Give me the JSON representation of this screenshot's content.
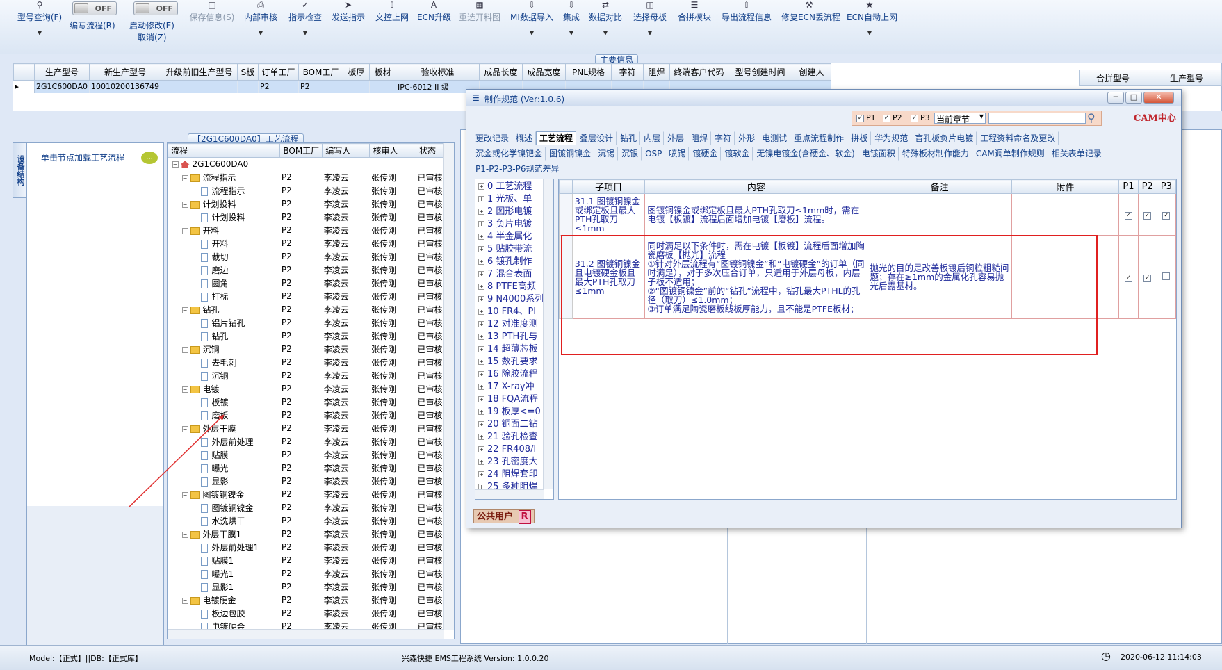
{
  "toolbar": {
    "model_query": "型号查询(F)",
    "edit_flow": "编写流程(R)",
    "edit_flow_toggle": "OFF",
    "start_modify": "启动修改(E)",
    "start_modify_toggle": "OFF",
    "cancel": "取消(Z)",
    "save_info": "保存信息(S)",
    "internal_review": "内部审核",
    "indicator_check": "指示检查",
    "send_indicator": "发送指示",
    "doc_upload": "文控上网",
    "ecn_upgrade": "ECN升级",
    "reselect_drawing": "重选开料图",
    "mi_import": "MI数据导入",
    "integrate": "集成",
    "data_compare": "数据对比",
    "select_template": "选择母板",
    "merge_module": "合拼模块",
    "export_flow_info": "导出流程信息",
    "fix_ecn_flow": "修复ECN丢流程",
    "ecn_auto_upload": "ECN自动上网"
  },
  "main_info": {
    "title": "主要信息",
    "columns": [
      "生产型号",
      "新生产型号",
      "升级前旧生产型号",
      "S板",
      "订单工厂",
      "BOM工厂",
      "板厚",
      "板材",
      "验收标准",
      "成品长度",
      "成品宽度",
      "PNL规格",
      "字符",
      "阻焊",
      "终端客户代码",
      "型号创建时间",
      "创建人"
    ],
    "row": [
      "2G1C600DA0",
      "10010200136749",
      "",
      "",
      "P2",
      "P2",
      "",
      "",
      "IPC-6012 II 级",
      "",
      "",
      "",
      "",
      "",
      "",
      "",
      ""
    ],
    "right_columns": [
      "合拼型号",
      "生产型号"
    ]
  },
  "left": {
    "vertical_tab": "设备结构",
    "node_hint": "单击节点加载工艺流程",
    "flow_title": "【2G1C600DA0】工艺流程",
    "columns": [
      "流程",
      "BOM工厂",
      "编写人",
      "核审人",
      "状态"
    ],
    "rows": [
      {
        "name": "2G1C600DA0",
        "level": 0,
        "kind": "root",
        "factory": "",
        "writer": "",
        "reviewer": "",
        "status": ""
      },
      {
        "name": "流程指示",
        "level": 1,
        "kind": "folder",
        "factory": "P2",
        "writer": "李凌云",
        "reviewer": "张传刚",
        "status": "已审核"
      },
      {
        "name": "流程指示",
        "level": 2,
        "kind": "doc",
        "factory": "P2",
        "writer": "李凌云",
        "reviewer": "张传刚",
        "status": "已审核"
      },
      {
        "name": "计划投料",
        "level": 1,
        "kind": "folder",
        "factory": "P2",
        "writer": "李凌云",
        "reviewer": "张传刚",
        "status": "已审核"
      },
      {
        "name": "计划投料",
        "level": 2,
        "kind": "doc",
        "factory": "P2",
        "writer": "李凌云",
        "reviewer": "张传刚",
        "status": "已审核"
      },
      {
        "name": "开料",
        "level": 1,
        "kind": "folder",
        "factory": "P2",
        "writer": "李凌云",
        "reviewer": "张传刚",
        "status": "已审核"
      },
      {
        "name": "开料",
        "level": 2,
        "kind": "doc",
        "factory": "P2",
        "writer": "李凌云",
        "reviewer": "张传刚",
        "status": "已审核"
      },
      {
        "name": "裁切",
        "level": 2,
        "kind": "doc",
        "factory": "P2",
        "writer": "李凌云",
        "reviewer": "张传刚",
        "status": "已审核"
      },
      {
        "name": "磨边",
        "level": 2,
        "kind": "doc",
        "factory": "P2",
        "writer": "李凌云",
        "reviewer": "张传刚",
        "status": "已审核"
      },
      {
        "name": "圆角",
        "level": 2,
        "kind": "doc",
        "factory": "P2",
        "writer": "李凌云",
        "reviewer": "张传刚",
        "status": "已审核"
      },
      {
        "name": "打标",
        "level": 2,
        "kind": "doc",
        "factory": "P2",
        "writer": "李凌云",
        "reviewer": "张传刚",
        "status": "已审核"
      },
      {
        "name": "钻孔",
        "level": 1,
        "kind": "folder",
        "factory": "P2",
        "writer": "李凌云",
        "reviewer": "张传刚",
        "status": "已审核"
      },
      {
        "name": "铝片钻孔",
        "level": 2,
        "kind": "doc",
        "factory": "P2",
        "writer": "李凌云",
        "reviewer": "张传刚",
        "status": "已审核"
      },
      {
        "name": "钻孔",
        "level": 2,
        "kind": "doc",
        "factory": "P2",
        "writer": "李凌云",
        "reviewer": "张传刚",
        "status": "已审核"
      },
      {
        "name": "沉铜",
        "level": 1,
        "kind": "folder",
        "factory": "P2",
        "writer": "李凌云",
        "reviewer": "张传刚",
        "status": "已审核"
      },
      {
        "name": "去毛刺",
        "level": 2,
        "kind": "doc",
        "factory": "P2",
        "writer": "李凌云",
        "reviewer": "张传刚",
        "status": "已审核"
      },
      {
        "name": "沉铜",
        "level": 2,
        "kind": "doc",
        "factory": "P2",
        "writer": "李凌云",
        "reviewer": "张传刚",
        "status": "已审核"
      },
      {
        "name": "电镀",
        "level": 1,
        "kind": "folder",
        "factory": "P2",
        "writer": "李凌云",
        "reviewer": "张传刚",
        "status": "已审核"
      },
      {
        "name": "板镀",
        "level": 2,
        "kind": "doc",
        "factory": "P2",
        "writer": "李凌云",
        "reviewer": "张传刚",
        "status": "已审核"
      },
      {
        "name": "磨板",
        "level": 2,
        "kind": "doc",
        "factory": "P2",
        "writer": "李凌云",
        "reviewer": "张传刚",
        "status": "已审核"
      },
      {
        "name": "外层干膜",
        "level": 1,
        "kind": "folder",
        "factory": "P2",
        "writer": "李凌云",
        "reviewer": "张传刚",
        "status": "已审核"
      },
      {
        "name": "外层前处理",
        "level": 2,
        "kind": "doc",
        "factory": "P2",
        "writer": "李凌云",
        "reviewer": "张传刚",
        "status": "已审核"
      },
      {
        "name": "贴膜",
        "level": 2,
        "kind": "doc",
        "factory": "P2",
        "writer": "李凌云",
        "reviewer": "张传刚",
        "status": "已审核"
      },
      {
        "name": "曝光",
        "level": 2,
        "kind": "doc",
        "factory": "P2",
        "writer": "李凌云",
        "reviewer": "张传刚",
        "status": "已审核"
      },
      {
        "name": "显影",
        "level": 2,
        "kind": "doc",
        "factory": "P2",
        "writer": "李凌云",
        "reviewer": "张传刚",
        "status": "已审核"
      },
      {
        "name": "图镀铜镍金",
        "level": 1,
        "kind": "folder",
        "factory": "P2",
        "writer": "李凌云",
        "reviewer": "张传刚",
        "status": "已审核"
      },
      {
        "name": "图镀铜镍金",
        "level": 2,
        "kind": "doc",
        "factory": "P2",
        "writer": "李凌云",
        "reviewer": "张传刚",
        "status": "已审核"
      },
      {
        "name": "水洗烘干",
        "level": 2,
        "kind": "doc",
        "factory": "P2",
        "writer": "李凌云",
        "reviewer": "张传刚",
        "status": "已审核"
      },
      {
        "name": "外层干膜1",
        "level": 1,
        "kind": "folder",
        "factory": "P2",
        "writer": "李凌云",
        "reviewer": "张传刚",
        "status": "已审核"
      },
      {
        "name": "外层前处理1",
        "level": 2,
        "kind": "doc",
        "factory": "P2",
        "writer": "李凌云",
        "reviewer": "张传刚",
        "status": "已审核"
      },
      {
        "name": "贴膜1",
        "level": 2,
        "kind": "doc",
        "factory": "P2",
        "writer": "李凌云",
        "reviewer": "张传刚",
        "status": "已审核"
      },
      {
        "name": "曝光1",
        "level": 2,
        "kind": "doc",
        "factory": "P2",
        "writer": "李凌云",
        "reviewer": "张传刚",
        "status": "已审核"
      },
      {
        "name": "显影1",
        "level": 2,
        "kind": "doc",
        "factory": "P2",
        "writer": "李凌云",
        "reviewer": "张传刚",
        "status": "已审核"
      },
      {
        "name": "电镀硬金",
        "level": 1,
        "kind": "folder",
        "factory": "P2",
        "writer": "李凌云",
        "reviewer": "张传刚",
        "status": "已审核"
      },
      {
        "name": "板边包胶",
        "level": 2,
        "kind": "doc",
        "factory": "P2",
        "writer": "李凌云",
        "reviewer": "张传刚",
        "status": "已审核"
      },
      {
        "name": "电镀硬金",
        "level": 2,
        "kind": "doc",
        "factory": "P2",
        "writer": "李凌云",
        "reviewer": "张传刚",
        "status": "已审核"
      }
    ]
  },
  "dialog": {
    "title": "制作规范 (Ver:1.0.6)",
    "filters": [
      {
        "label": "P1",
        "checked": true
      },
      {
        "label": "P2",
        "checked": true
      },
      {
        "label": "P3",
        "checked": true
      }
    ],
    "scope_select": "当前章节",
    "search_value": "",
    "cam_logo": "CAM中心",
    "tabs_row1": [
      "更改记录",
      "概述",
      "工艺流程",
      "叠层设计",
      "钻孔",
      "内层",
      "外层",
      "阻焊",
      "字符",
      "外形",
      "电测试",
      "重点流程制作",
      "拼板",
      "华为规范",
      "盲孔板负片电镀",
      "工程资料命名及更改"
    ],
    "tabs_row2": [
      "沉金或化学镍钯金",
      "图镀铜镍金",
      "沉锡",
      "沉银",
      "OSP",
      "喷锡",
      "镀硬金",
      "镀软金",
      "无镍电镀金(含硬金、软金)",
      "电镀面积",
      "特殊板材制作能力",
      "CAM调单制作规则",
      "相关表单记录"
    ],
    "tabs_row3": [
      "P1-P2-P3-P6规范差异"
    ],
    "active_tab": "工艺流程",
    "chapters": [
      "0 工艺流程",
      "1 光板、单",
      "2 图形电镀",
      "3 负片电镀",
      "4 半金属化",
      "5 贴胶带流",
      "6 镀孔制作",
      "7 混合表面",
      "8 PTFE高频",
      "9 N4000系列",
      "10 FR4、PI",
      "12 对准度测",
      "13 PTH孔与",
      "14 超薄芯板",
      "15 数孔要求",
      "16 除胶流程",
      "17 X-ray冲",
      "18 FQA流程",
      "19 板厚<=0",
      "20 铜面二钻",
      "21 验孔检查",
      "22 FR408/I",
      "23 孔密度大",
      "24 阻焊套印",
      "25 多种阻焊"
    ],
    "spec_columns": [
      "子项目",
      "内容",
      "备注",
      "附件",
      "P1",
      "P2",
      "P3"
    ],
    "spec_rows": [
      {
        "item": "31.1 图镀铜镍金或绑定板且最大PTH孔取刀≤1mm",
        "content": "图镀铜镍金或绑定板且最大PTH孔取刀≤1mm时，需在电镀【板镀】流程后面增加电镀【磨板】流程。",
        "remark": "",
        "attachment": "",
        "p1": true,
        "p2": true,
        "p3": true
      },
      {
        "item": "31.2 图镀铜镍金且电镀硬金板且最大PTH孔取刀≤1mm",
        "content": "同时满足以下条件时，需在电镀【板镀】流程后面增加陶瓷磨板【抛光】流程\n①针对外层流程有“图镀铜镍金”和“电镀硬金”的订单（同时满足），对于多次压合订单，只适用于外层母板，内层子板不适用；\n②“图镀铜镍金”前的“钻孔”流程中，钻孔最大PTHL的孔径（取刀）≤1.0mm；\n③订单满足陶瓷磨板线板厚能力，且不能是PTFE板材；",
        "remark": "抛光的目的是改善板镀后铜粒粗糙问题；存在≥1mm的金属化孔容易抛光后露基材。",
        "attachment": "",
        "p1": true,
        "p2": true,
        "p3": false
      }
    ],
    "user_badge": "公共用户",
    "user_badge_r": "R"
  },
  "status_bar": {
    "model": "Model:【正式】||DB:【正式库】",
    "system": "兴森快捷 EMS工程系统 Version: 1.0.0.20",
    "datetime": "2020-06-12 11:14:03"
  }
}
